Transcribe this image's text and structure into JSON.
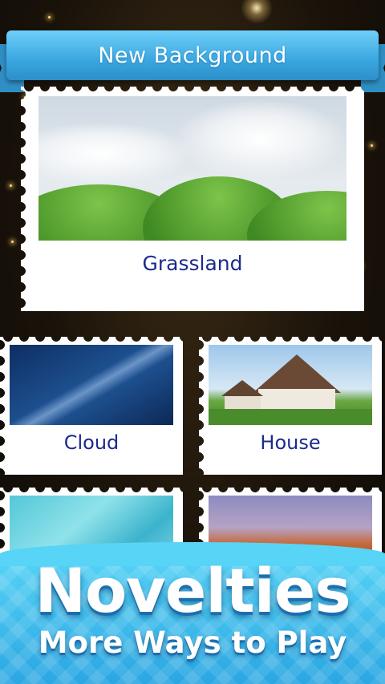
{
  "header": {
    "title": "New Background"
  },
  "featured": {
    "label": "Grassland"
  },
  "grid": [
    {
      "label": "Cloud"
    },
    {
      "label": "House"
    },
    {
      "label": ""
    },
    {
      "label": ""
    }
  ],
  "promo": {
    "headline": "Novelties",
    "subline": "More Ways to Play"
  },
  "colors": {
    "ribbon": "#3aa6e0",
    "label_text": "#1d2a8c",
    "banner": "#2aa6e2"
  }
}
